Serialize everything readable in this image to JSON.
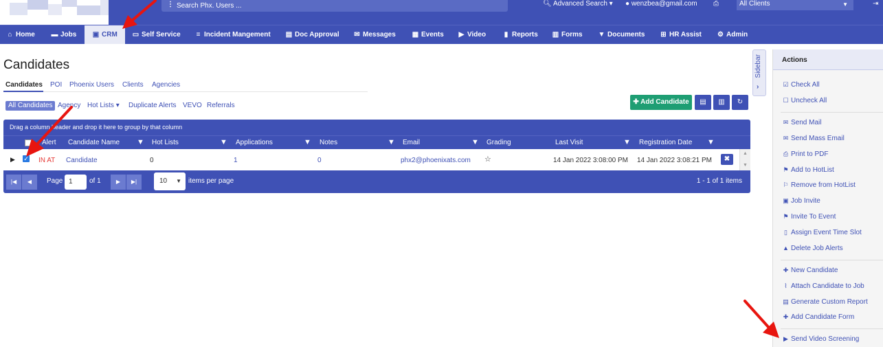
{
  "header": {
    "search_placeholder": "Search Phx. Users ...",
    "advanced_search": "Advanced Search",
    "user_email": "wenzbea@gmail.com",
    "client_select": "All Clients"
  },
  "nav": [
    {
      "label": "Home",
      "icon": "home-icon"
    },
    {
      "label": "Jobs",
      "icon": "folder-icon"
    },
    {
      "label": "CRM",
      "icon": "briefcase-icon"
    },
    {
      "label": "Self Service",
      "icon": "monitor-icon"
    },
    {
      "label": "Incident Mangement",
      "icon": "list-icon"
    },
    {
      "label": "Doc Approval",
      "icon": "document-icon"
    },
    {
      "label": "Messages",
      "icon": "envelope-icon"
    },
    {
      "label": "Events",
      "icon": "calendar-icon"
    },
    {
      "label": "Video",
      "icon": "video-icon"
    },
    {
      "label": "Reports",
      "icon": "book-icon"
    },
    {
      "label": "Forms",
      "icon": "form-icon"
    },
    {
      "label": "Documents",
      "icon": "filter-icon"
    },
    {
      "label": "HR Assist",
      "icon": "sitemap-icon"
    },
    {
      "label": "Admin",
      "icon": "gear-icon"
    }
  ],
  "page": {
    "title": "Candidates",
    "tabs": [
      "Candidates",
      "POI",
      "Phoenix Users",
      "Clients",
      "Agencies"
    ],
    "filters": [
      "All Candidates",
      "Agency",
      "Hot Lists",
      "Duplicate Alerts",
      "VEVO",
      "Referrals"
    ],
    "add_candidate": "Add Candidate"
  },
  "grid": {
    "group_hint": "Drag a column header and drop it here to group by that column",
    "columns": [
      "Alert",
      "Candidate Name",
      "Hot Lists",
      "Applications",
      "Notes",
      "Email",
      "Grading",
      "Last Visit",
      "Registration Date"
    ],
    "rows": [
      {
        "alert": "IN AT",
        "name": "Candidate",
        "hot_lists": "0",
        "applications": "1",
        "notes": "0",
        "email": "phx2@phoenixats.com",
        "grading": "☆",
        "last_visit": "14 Jan 2022 3:08:00 PM",
        "registration_date": "14 Jan 2022 3:08:21 PM"
      }
    ],
    "pager": {
      "page_label": "Page",
      "page": "1",
      "of_pages": "of 1",
      "per_page": "10",
      "per_page_label": "items per page",
      "count": "1 - 1 of 1 items"
    }
  },
  "sidebar_toggle": "Sidebar",
  "actions": {
    "title": "Actions",
    "groups": [
      [
        {
          "label": "Check All",
          "icon": "check-square-icon"
        },
        {
          "label": "Uncheck All",
          "icon": "square-icon"
        }
      ],
      [
        {
          "label": "Send Mail",
          "icon": "envelope-icon"
        },
        {
          "label": "Send Mass Email",
          "icon": "envelope-icon"
        },
        {
          "label": "Print to PDF",
          "icon": "printer-icon"
        },
        {
          "label": "Add to HotList",
          "icon": "flag-icon"
        },
        {
          "label": "Remove from HotList",
          "icon": "flag-outline-icon"
        },
        {
          "label": "Job Invite",
          "icon": "briefcase-icon"
        },
        {
          "label": "Invite To Event",
          "icon": "flag-icon"
        },
        {
          "label": "Assign Event Time Slot",
          "icon": "mobile-icon"
        },
        {
          "label": "Delete Job Alerts",
          "icon": "warning-icon"
        }
      ],
      [
        {
          "label": "New Candidate",
          "icon": "plus-icon"
        },
        {
          "label": "Attach Candidate to Job",
          "icon": "paperclip-icon"
        },
        {
          "label": "Generate Custom Report",
          "icon": "report-icon"
        },
        {
          "label": "Add Candidate Form",
          "icon": "plus-icon"
        },
        {
          "label": "Send Video Screening",
          "icon": "video-icon"
        }
      ]
    ]
  },
  "colors": {
    "primary": "#3f51b5",
    "accent_green": "#1e9e73",
    "alert_red": "#e53935",
    "annotation_red": "#e8150f"
  }
}
